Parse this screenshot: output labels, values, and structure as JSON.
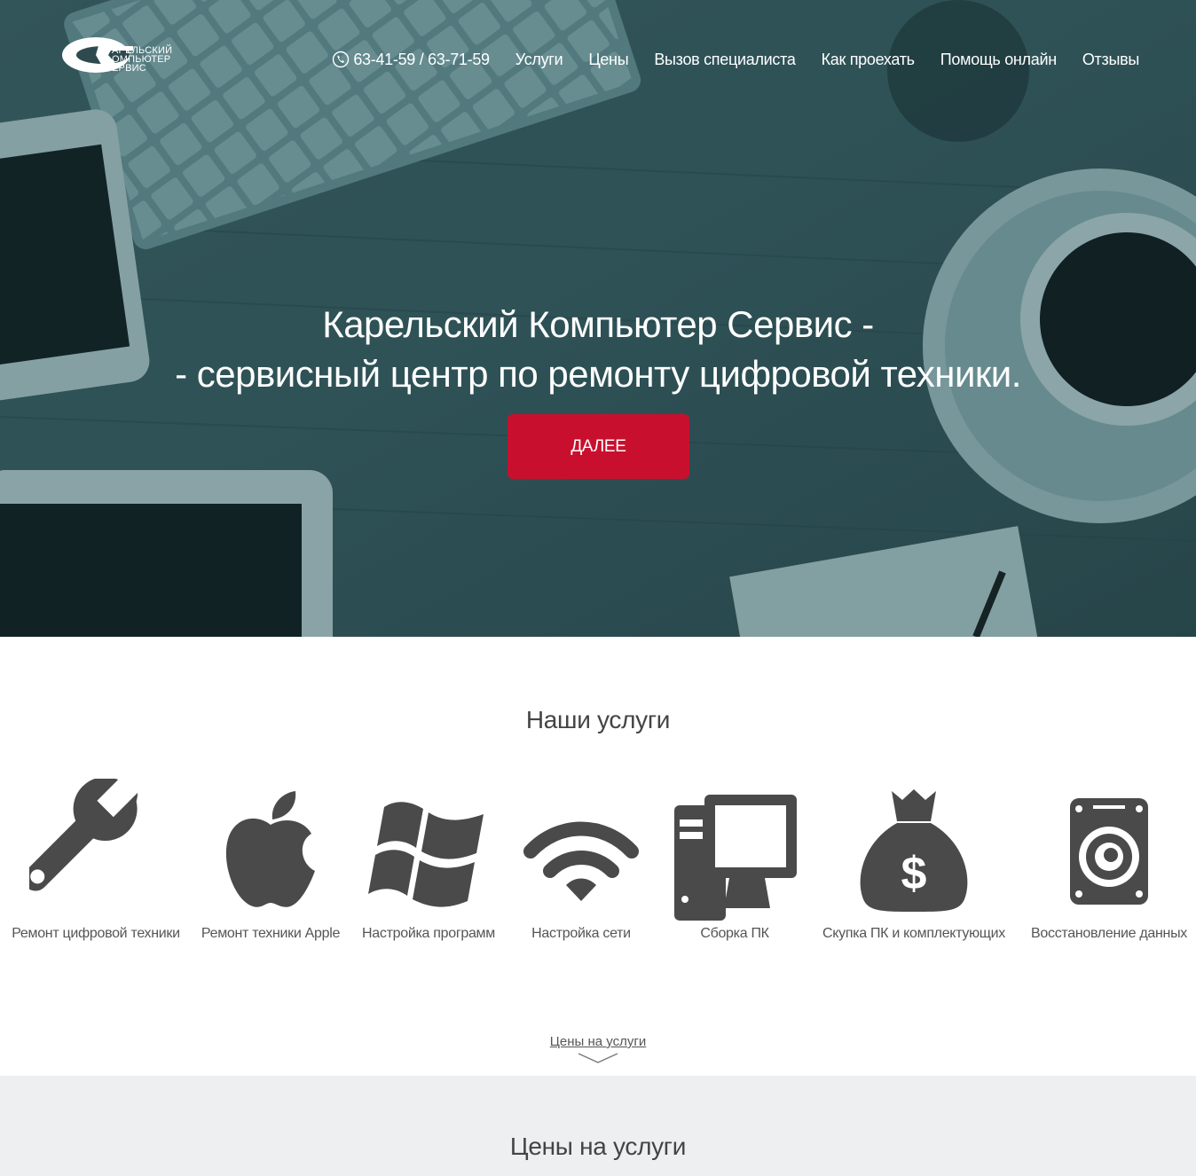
{
  "logo": {
    "line1": "АРЕЛЬСКИЙ",
    "line2": "ОМПЬЮТЕР",
    "line3": "ЕРВИС"
  },
  "nav": {
    "phone": "63-41-59 / 63-71-59",
    "items": [
      "Услуги",
      "Цены",
      "Вызов специалиста",
      "Как проехать",
      "Помощь онлайн",
      "Отзывы"
    ]
  },
  "hero": {
    "title_line1": "Карельский Компьютер Сервис -",
    "title_line2": "- сервисный центр по ремонту цифровой техники.",
    "cta": "ДАЛЕЕ"
  },
  "services": {
    "title": "Наши услуги",
    "items": [
      {
        "label": "Ремонт цифровой техники",
        "icon": "wrench-icon"
      },
      {
        "label": "Ремонт техники Apple",
        "icon": "apple-icon"
      },
      {
        "label": "Настройка программ",
        "icon": "windows-icon"
      },
      {
        "label": "Настройка сети",
        "icon": "wifi-icon"
      },
      {
        "label": "Сборка ПК",
        "icon": "computer-icon"
      },
      {
        "label": "Скупка ПК и комплектующих",
        "icon": "money-bag-icon"
      },
      {
        "label": "Восстановление данных",
        "icon": "hard-drive-icon"
      }
    ],
    "more_link": "Цены на услуги"
  },
  "prices": {
    "title": "Цены на услуги"
  },
  "colors": {
    "accent": "#c8102e",
    "icon": "#4a4a4a",
    "hero_tint": "#2f4a4e"
  }
}
